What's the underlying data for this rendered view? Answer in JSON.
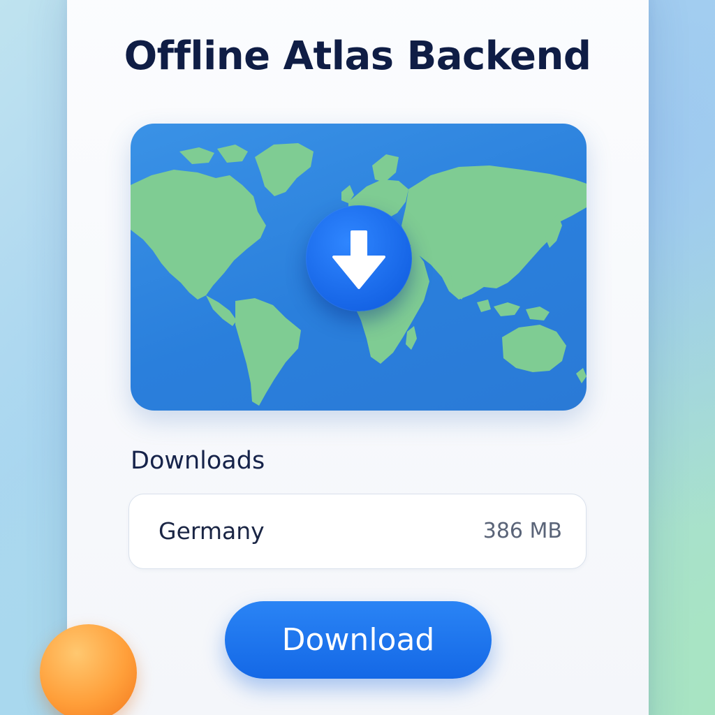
{
  "header": {
    "title": "Offline Atlas Backend"
  },
  "map": {
    "ocean_color": "#2a80dc",
    "land_color": "#7fcc93",
    "badge_icon": "download-arrow-icon",
    "badge_color": "#1665e6"
  },
  "downloads": {
    "section_label": "Downloads",
    "items": [
      {
        "name": "Germany",
        "size": "386 MB"
      }
    ]
  },
  "actions": {
    "download_label": "Download",
    "accent_color": "#1a6fea"
  },
  "decoration": {
    "orb_color": "#ff9a35"
  }
}
